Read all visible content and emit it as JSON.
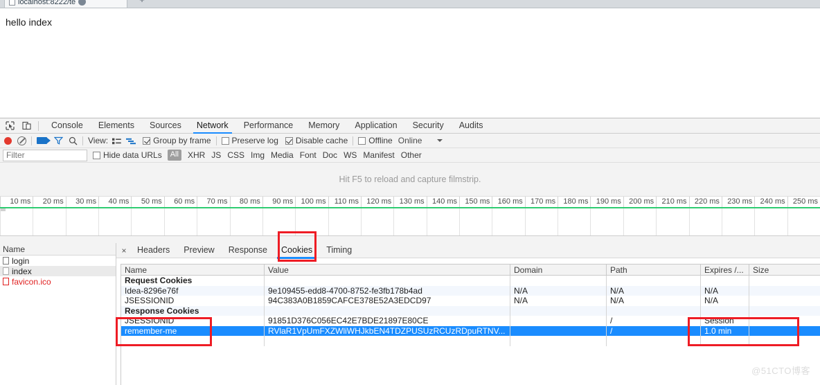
{
  "browser": {
    "tab_title": "localhost:8222/te",
    "new_tab_label": "+",
    "favicon_name": "page-favicon"
  },
  "page": {
    "body_text": "hello index"
  },
  "devtools": {
    "main_tabs": [
      {
        "label": "Console",
        "active": false
      },
      {
        "label": "Elements",
        "active": false
      },
      {
        "label": "Sources",
        "active": false
      },
      {
        "label": "Network",
        "active": true
      },
      {
        "label": "Performance",
        "active": false
      },
      {
        "label": "Memory",
        "active": false
      },
      {
        "label": "Application",
        "active": false
      },
      {
        "label": "Security",
        "active": false
      },
      {
        "label": "Audits",
        "active": false
      }
    ],
    "toolbar": {
      "record_tooltip": "record-button",
      "clear_tooltip": "clear-button",
      "view_label": "View:",
      "group_by_frame_label": "Group by frame",
      "group_by_frame_checked": true,
      "preserve_log_label": "Preserve log",
      "preserve_log_checked": false,
      "disable_cache_label": "Disable cache",
      "disable_cache_checked": true,
      "offline_label": "Offline",
      "offline_checked": false,
      "throttling_value": "Online"
    },
    "filterbar": {
      "filter_placeholder": "Filter",
      "filter_value": "",
      "hide_data_urls_label": "Hide data URLs",
      "hide_data_urls_checked": false,
      "types": [
        "All",
        "XHR",
        "JS",
        "CSS",
        "Img",
        "Media",
        "Font",
        "Doc",
        "WS",
        "Manifest",
        "Other"
      ],
      "active_type": "All"
    },
    "filmstrip": {
      "hint": "Hit F5 to reload and capture filmstrip."
    },
    "timeline": {
      "ticks": [
        "10 ms",
        "20 ms",
        "30 ms",
        "40 ms",
        "50 ms",
        "60 ms",
        "70 ms",
        "80 ms",
        "90 ms",
        "100 ms",
        "110 ms",
        "120 ms",
        "130 ms",
        "140 ms",
        "150 ms",
        "160 ms",
        "170 ms",
        "180 ms",
        "190 ms",
        "200 ms",
        "210 ms",
        "220 ms",
        "230 ms",
        "240 ms",
        "250 ms"
      ],
      "bar_color": "#2ecc71"
    },
    "request_list": {
      "header": "Name",
      "rows": [
        {
          "name": "login",
          "state": "normal"
        },
        {
          "name": "index",
          "state": "selected"
        },
        {
          "name": "favicon.ico",
          "state": "error"
        }
      ]
    },
    "detail": {
      "close_label": "×",
      "tabs": [
        {
          "label": "Headers",
          "active": false
        },
        {
          "label": "Preview",
          "active": false
        },
        {
          "label": "Response",
          "active": false
        },
        {
          "label": "Cookies",
          "active": true
        },
        {
          "label": "Timing",
          "active": false
        }
      ],
      "cookie_table": {
        "columns": [
          "Name",
          "Value",
          "Domain",
          "Path",
          "Expires /...",
          "Size"
        ],
        "rows": [
          {
            "kind": "group",
            "name": "Request Cookies",
            "value": "",
            "domain": "",
            "path": "",
            "expires": "",
            "size": ""
          },
          {
            "kind": "data",
            "name": "Idea-8296e76f",
            "value": "9e109455-edd8-4700-8752-fe3fb178b4ad",
            "domain": "N/A",
            "path": "N/A",
            "expires": "N/A",
            "size": ""
          },
          {
            "kind": "data",
            "name": "JSESSIONID",
            "value": "94C383A0B1859CAFCE378E52A3EDCD97",
            "domain": "N/A",
            "path": "N/A",
            "expires": "N/A",
            "size": ""
          },
          {
            "kind": "group",
            "name": "Response Cookies",
            "value": "",
            "domain": "",
            "path": "",
            "expires": "",
            "size": ""
          },
          {
            "kind": "data",
            "name": "JSESSIONID",
            "value": "91851D376C056EC42E7BDE21897E80CE",
            "domain": "",
            "path": "/",
            "expires": "Session",
            "size": ""
          },
          {
            "kind": "selected",
            "name": "remember-me",
            "value": "RVlaR1VpUmFXZWliWHJkbEN4TDZPUSUzRCUzRDpuRTNV...",
            "domain": "",
            "path": "/",
            "expires": "1.0 min",
            "size": ""
          }
        ]
      }
    }
  },
  "annotations": {
    "color": "#ee1c25",
    "boxes": [
      "cookies-tab",
      "remember-me-cell",
      "expires-cell"
    ]
  },
  "watermark": {
    "text": "@51CTO博客"
  }
}
